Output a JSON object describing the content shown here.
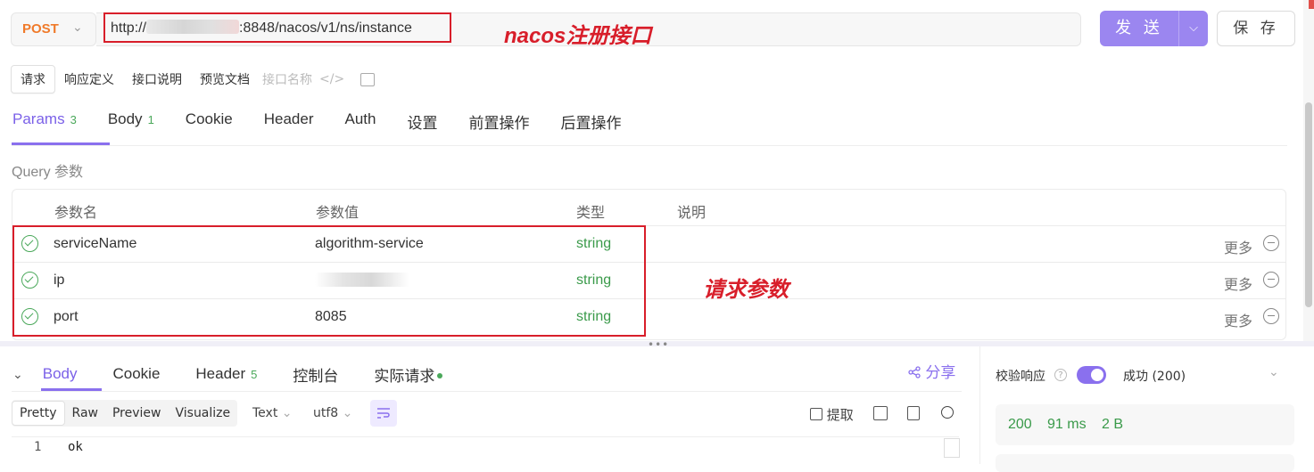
{
  "request": {
    "method": "POST",
    "url_prefix": "http://",
    "url_suffix": ":8848/nacos/v1/ns/instance",
    "send_label": "发 送",
    "save_label": "保 存"
  },
  "annotations": {
    "url_label": "nacos注册接口",
    "params_label": "请求参数"
  },
  "subtabs": [
    "请求",
    "响应定义",
    "接口说明",
    "预览文档",
    "接口名称"
  ],
  "param_tabs": [
    {
      "label": "Params",
      "count": "3"
    },
    {
      "label": "Body",
      "count": "1"
    },
    {
      "label": "Cookie",
      "count": ""
    },
    {
      "label": "Header",
      "count": ""
    },
    {
      "label": "Auth",
      "count": ""
    },
    {
      "label": "设置",
      "count": ""
    },
    {
      "label": "前置操作",
      "count": ""
    },
    {
      "label": "后置操作",
      "count": ""
    }
  ],
  "query": {
    "title": "Query 参数",
    "headers": [
      "参数名",
      "参数值",
      "类型",
      "说明"
    ],
    "rows": [
      {
        "name": "serviceName",
        "value": "algorithm-service",
        "type": "string",
        "more": "更多"
      },
      {
        "name": "ip",
        "value": "",
        "type": "string",
        "more": "更多"
      },
      {
        "name": "port",
        "value": "8085",
        "type": "string",
        "more": "更多"
      }
    ]
  },
  "response": {
    "tabs": [
      {
        "label": "Body",
        "count": ""
      },
      {
        "label": "Cookie",
        "count": ""
      },
      {
        "label": "Header",
        "count": "5"
      },
      {
        "label": "控制台",
        "count": ""
      },
      {
        "label": "实际请求",
        "count": ""
      }
    ],
    "share_label": "分享",
    "formats": [
      "Pretty",
      "Raw",
      "Preview",
      "Visualize"
    ],
    "type_select": "Text",
    "encoding_select": "utf8",
    "extract_label": "提取",
    "line_number": "1",
    "body_text": "ok"
  },
  "validation": {
    "label": "校验响应",
    "status": "成功 (200)",
    "code": "200",
    "time": "91 ms",
    "size": "2 B"
  },
  "colors": {
    "accent": "#8a70ee",
    "method": "#f07a2a",
    "annotation_red": "#d81e2a",
    "success_green": "#3a9a4a"
  }
}
